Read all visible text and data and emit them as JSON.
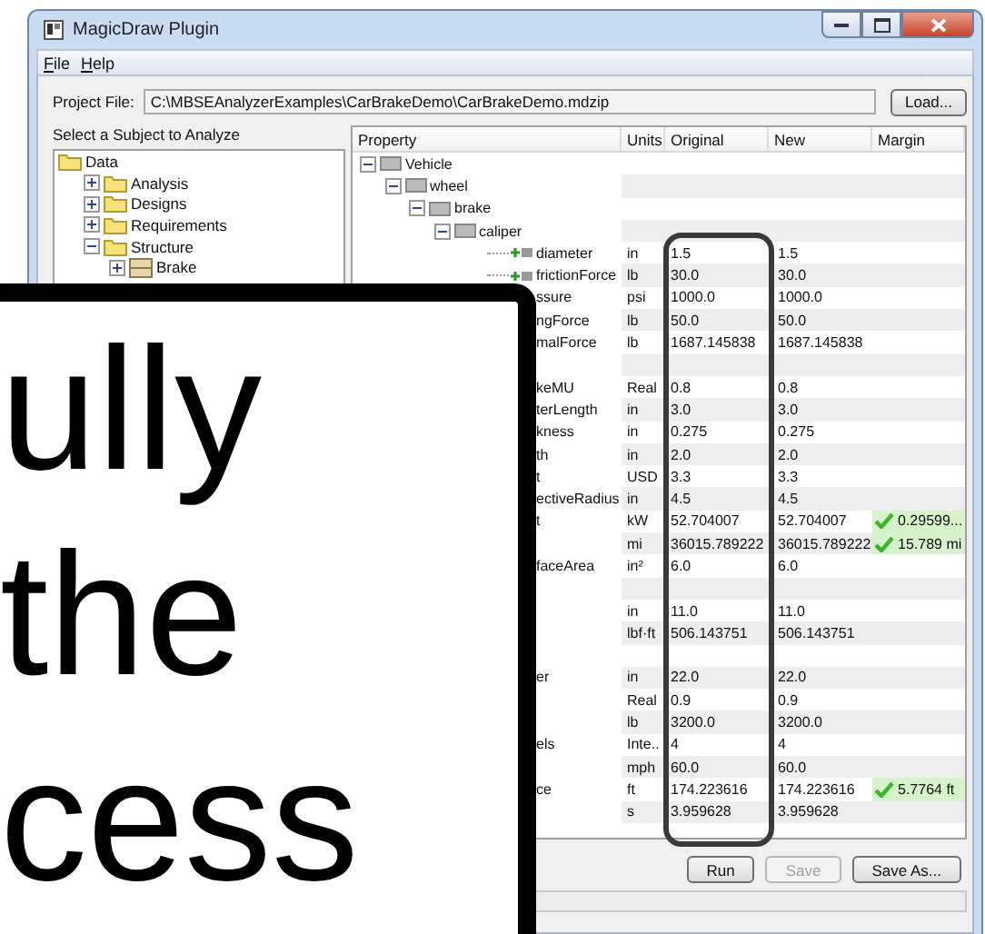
{
  "window": {
    "title": "MagicDraw Plugin"
  },
  "menu": [
    "File",
    "Help"
  ],
  "project": {
    "label": "Project File:",
    "value": "C:\\MBSEAnalyzerExamples\\CarBrakeDemo\\CarBrakeDemo.mdzip",
    "button": "Load..."
  },
  "subject_tree": {
    "title": "Select a Subject to Analyze",
    "items": [
      {
        "label": "Data",
        "kind": "folder",
        "children": [
          {
            "label": "Analysis",
            "kind": "folder",
            "expanded": false
          },
          {
            "label": "Designs",
            "kind": "folder",
            "expanded": false
          },
          {
            "label": "Requirements",
            "kind": "folder",
            "expanded": false
          },
          {
            "label": "Structure",
            "kind": "folder",
            "expanded": true,
            "children": [
              {
                "label": "Brake",
                "kind": "block",
                "expanded": false
              }
            ]
          }
        ]
      }
    ]
  },
  "table": {
    "columns": [
      "Property",
      "Units",
      "Original",
      "New",
      "Margin"
    ],
    "rows": [
      {
        "label": "Vehicle",
        "expanded": true,
        "children": [
          {
            "label": "wheel",
            "expanded": true,
            "children": [
              {
                "label": "brake",
                "expanded": true,
                "children": [
                  {
                    "label": "caliper",
                    "expanded": true,
                    "children": [
                      {
                        "label": "diameter",
                        "icon": true,
                        "units": "in",
                        "original": "1.5",
                        "new": "1.5"
                      },
                      {
                        "label": "frictionForce",
                        "icon": true,
                        "units": "lb",
                        "original": "30.0",
                        "new": "30.0"
                      },
                      {
                        "label": "ssure",
                        "units": "psi",
                        "original": "1000.0",
                        "new": "1000.0"
                      },
                      {
                        "label": "ngForce",
                        "units": "lb",
                        "original": "50.0",
                        "new": "50.0"
                      },
                      {
                        "label": "malForce",
                        "units": "lb",
                        "original": "1687.145838",
                        "new": "1687.145838"
                      }
                    ]
                  },
                  {
                    "children": [
                      {
                        "label": "keMU",
                        "units": "Real",
                        "original": "0.8",
                        "new": "0.8"
                      },
                      {
                        "label": "terLength",
                        "units": "in",
                        "original": "3.0",
                        "new": "3.0"
                      },
                      {
                        "label": "kness",
                        "units": "in",
                        "original": "0.275",
                        "new": "0.275"
                      },
                      {
                        "label": "th",
                        "units": "in",
                        "original": "2.0",
                        "new": "2.0"
                      },
                      {
                        "label": "t",
                        "units": "USD",
                        "original": "3.3",
                        "new": "3.3"
                      },
                      {
                        "label": "ectiveRadius",
                        "units": "in",
                        "original": "4.5",
                        "new": "4.5"
                      },
                      {
                        "label": "t",
                        "units": "kW",
                        "original": "52.704007",
                        "new": "52.704007",
                        "margin": {
                          "text": "0.29599...",
                          "pass": true
                        }
                      },
                      {
                        "units": "mi",
                        "original": "36015.789222",
                        "new": "36015.789222",
                        "margin": {
                          "text": "15.789 mi",
                          "pass": true
                        }
                      },
                      {
                        "label": "faceArea",
                        "units": "in²",
                        "original": "6.0",
                        "new": "6.0"
                      }
                    ]
                  },
                  {
                    "children": [
                      {
                        "units": "in",
                        "original": "11.0",
                        "new": "11.0"
                      },
                      {
                        "units": "lbf·ft",
                        "original": "506.143751",
                        "new": "506.143751"
                      }
                    ]
                  },
                  {
                    "children": [
                      {
                        "label": "er",
                        "units": "in",
                        "original": "22.0",
                        "new": "22.0"
                      },
                      {
                        "units": "Real",
                        "original": "0.9",
                        "new": "0.9"
                      },
                      {
                        "units": "lb",
                        "original": "3200.0",
                        "new": "3200.0"
                      },
                      {
                        "label": "els",
                        "units": "Inte..",
                        "original": "4",
                        "new": "4"
                      },
                      {
                        "units": "mph",
                        "original": "60.0",
                        "new": "60.0"
                      },
                      {
                        "label": "ce",
                        "units": "ft",
                        "original": "174.223616",
                        "new": "174.223616",
                        "margin": {
                          "text": "5.7764 ft",
                          "pass": true
                        }
                      },
                      {
                        "units": "s",
                        "original": "3.959628",
                        "new": "3.959628"
                      }
                    ]
                  }
                ]
              }
            ]
          }
        ]
      }
    ]
  },
  "buttons": [
    {
      "label": "Run",
      "disabled": false
    },
    {
      "label": "Save",
      "disabled": true
    },
    {
      "label": "Save As...",
      "disabled": false
    }
  ],
  "callout": {
    "lines": [
      "ully",
      "the",
      "cess"
    ]
  }
}
